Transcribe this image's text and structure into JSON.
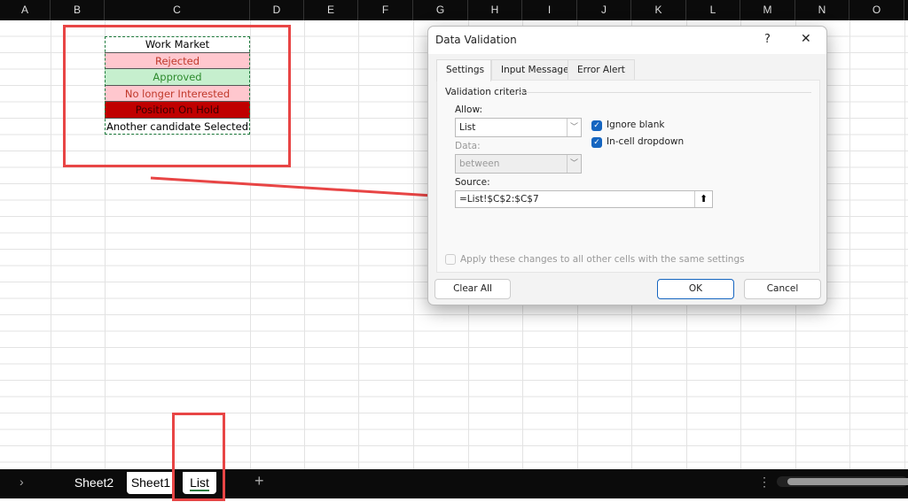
{
  "columns": [
    "A",
    "B",
    "C",
    "D",
    "E",
    "F",
    "G",
    "H",
    "I",
    "J",
    "K",
    "L",
    "M",
    "N",
    "O"
  ],
  "list_cells": [
    {
      "text": "Work Market",
      "bg": "#ffffff",
      "color": "#000000"
    },
    {
      "text": "Rejected",
      "bg": "#ffc7ce",
      "color": "#c0392b"
    },
    {
      "text": "Approved",
      "bg": "#c6efce",
      "color": "#2e8b2e"
    },
    {
      "text": "No longer Interested",
      "bg": "#ffc7ce",
      "color": "#c0392b"
    },
    {
      "text": "Position On Hold",
      "bg": "#c00000",
      "color": "#3a0000"
    },
    {
      "text": "Another candidate Selected",
      "bg": "#ffffff",
      "color": "#000000"
    }
  ],
  "dialog": {
    "title": "Data Validation",
    "help": "?",
    "close": "✕",
    "tabs": [
      "Settings",
      "Input Message",
      "Error Alert"
    ],
    "section": "Validation criteria",
    "allow_label": "Allow:",
    "allow_value": "List",
    "data_label": "Data:",
    "data_value": "between",
    "ignore_blank": "Ignore blank",
    "ignore_blank_checked": true,
    "incell": "In-cell dropdown",
    "incell_checked": true,
    "source_label": "Source:",
    "source_value": "=List!$C$2:$C$7",
    "apply_all": "Apply these changes to all other cells with the same settings",
    "clear_all": "Clear All",
    "ok": "OK",
    "cancel": "Cancel"
  },
  "sheets": {
    "tabs": [
      "Sheet2",
      "Sheet1",
      "List"
    ],
    "active": "List",
    "add": "+"
  },
  "colors": {
    "annotation": "#e84545",
    "accent": "#1565c0"
  }
}
